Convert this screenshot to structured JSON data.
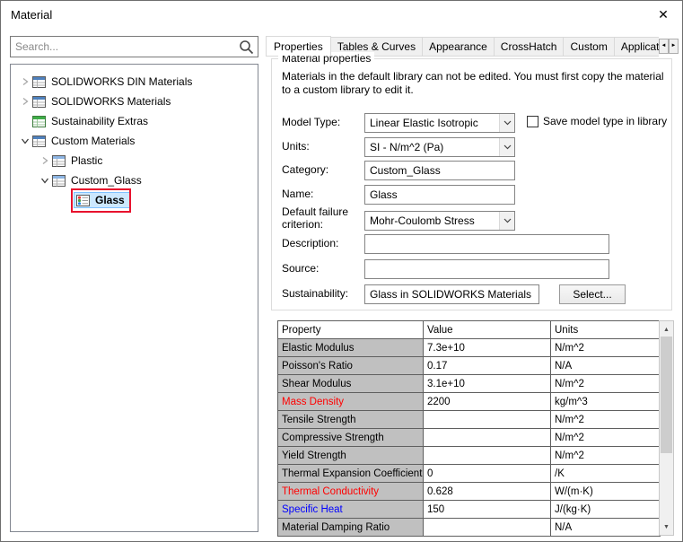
{
  "colors": {
    "emphasis_red": "#ff0000",
    "emphasis_blue": "#0000ff",
    "selection_bg": "#cce8ff",
    "annotation_red": "#e8112d",
    "property_column_bg": "#c0c0c0"
  },
  "icons": {
    "close": "✕",
    "tab_prev": "◄",
    "tab_next": "►",
    "scroll_up": "▲",
    "scroll_down": "▼"
  },
  "window": {
    "title": "Material"
  },
  "left_panel": {
    "search": {
      "placeholder": "Search...",
      "value": ""
    },
    "tree": {
      "items": [
        {
          "label": "SOLIDWORKS DIN Materials",
          "level": 1,
          "state": "collapsed",
          "icon": "material-library-icon",
          "selected": false
        },
        {
          "label": "SOLIDWORKS Materials",
          "level": 1,
          "state": "collapsed",
          "icon": "material-library-icon",
          "selected": false
        },
        {
          "label": "Sustainability Extras",
          "level": 1,
          "state": "none",
          "icon": "sustainability-library-icon",
          "selected": false
        },
        {
          "label": "Custom Materials",
          "level": 1,
          "state": "expanded",
          "icon": "material-library-icon",
          "selected": false
        },
        {
          "label": "Plastic",
          "level": 2,
          "state": "collapsed",
          "icon": "material-category-icon",
          "selected": false
        },
        {
          "label": "Custom_Glass",
          "level": 2,
          "state": "expanded",
          "icon": "material-category-icon",
          "selected": false
        },
        {
          "label": "Glass",
          "level": 3,
          "state": "none",
          "icon": "material-icon",
          "selected": true,
          "annotated": true
        }
      ]
    }
  },
  "tabs": {
    "items": [
      {
        "label": "Properties",
        "active": true
      },
      {
        "label": "Tables & Curves",
        "active": false
      },
      {
        "label": "Appearance",
        "active": false
      },
      {
        "label": "CrossHatch",
        "active": false
      },
      {
        "label": "Custom",
        "active": false
      },
      {
        "label": "Application Da",
        "active": false
      }
    ]
  },
  "material_properties": {
    "group_title": "Material properties",
    "notice": "Materials in the default library can not be edited. You must first copy the material to a custom library to edit it.",
    "model_type": {
      "label": "Model Type:",
      "value": "Linear Elastic Isotropic"
    },
    "save_model_type": {
      "label": "Save model type in library",
      "checked": false
    },
    "units": {
      "label": "Units:",
      "value": "SI - N/m^2 (Pa)"
    },
    "category": {
      "label": "Category:",
      "value": "Custom_Glass"
    },
    "name": {
      "label": "Name:",
      "value": "Glass"
    },
    "failure_criterion": {
      "label": "Default failure criterion:",
      "value": "Mohr-Coulomb Stress"
    },
    "description": {
      "label": "Description:",
      "value": ""
    },
    "source": {
      "label": "Source:",
      "value": ""
    },
    "sustainability": {
      "label": "Sustainability:",
      "value": "Glass in SOLIDWORKS Materials : Oth",
      "button_label": "Select..."
    }
  },
  "property_table": {
    "headers": {
      "property": "Property",
      "value": "Value",
      "units": "Units"
    },
    "rows": [
      {
        "property": "Elastic Modulus",
        "value": "7.3e+10",
        "units": "N/m^2",
        "emphasis": "none"
      },
      {
        "property": "Poisson's Ratio",
        "value": "0.17",
        "units": "N/A",
        "emphasis": "none"
      },
      {
        "property": "Shear Modulus",
        "value": "3.1e+10",
        "units": "N/m^2",
        "emphasis": "none"
      },
      {
        "property": "Mass Density",
        "value": "2200",
        "units": "kg/m^3",
        "emphasis": "red"
      },
      {
        "property": "Tensile Strength",
        "value": "",
        "units": "N/m^2",
        "emphasis": "none"
      },
      {
        "property": "Compressive Strength",
        "value": "",
        "units": "N/m^2",
        "emphasis": "none"
      },
      {
        "property": "Yield Strength",
        "value": "",
        "units": "N/m^2",
        "emphasis": "none"
      },
      {
        "property": "Thermal Expansion Coefficient",
        "value": "0",
        "units": "/K",
        "emphasis": "none"
      },
      {
        "property": "Thermal Conductivity",
        "value": "0.628",
        "units": "W/(m·K)",
        "emphasis": "red"
      },
      {
        "property": "Specific Heat",
        "value": "150",
        "units": "J/(kg·K)",
        "emphasis": "blue"
      },
      {
        "property": "Material Damping Ratio",
        "value": "",
        "units": "N/A",
        "emphasis": "none"
      }
    ]
  }
}
